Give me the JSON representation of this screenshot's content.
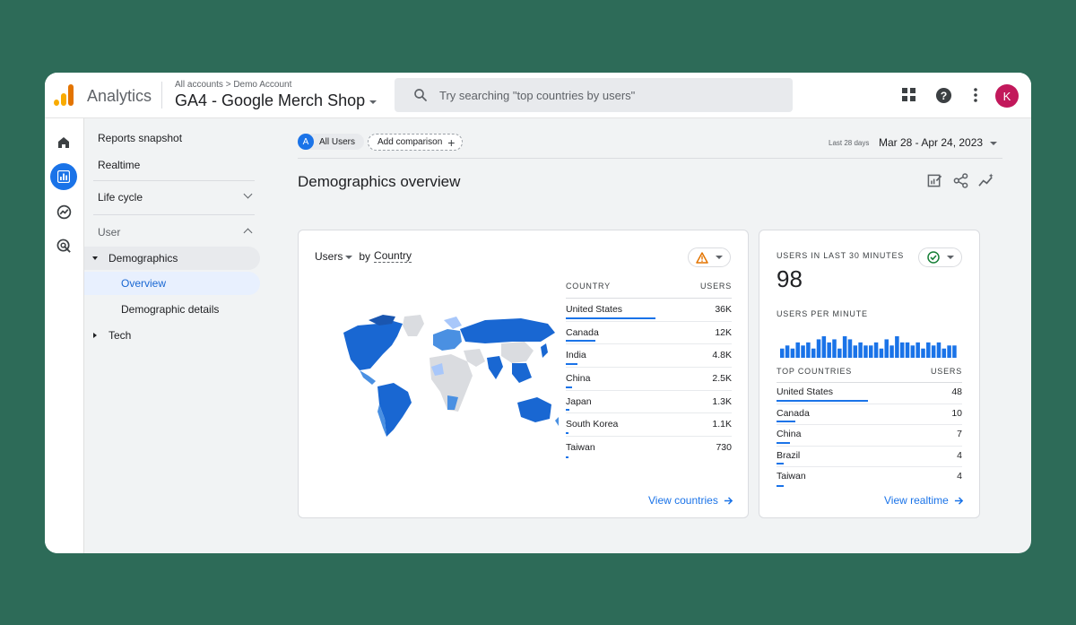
{
  "header": {
    "app_name": "Analytics",
    "breadcrumb": "All accounts > Demo Account",
    "property_name": "GA4 - Google Merch Shop",
    "search_placeholder": "Try searching \"top countries by users\"",
    "avatar_initial": "K"
  },
  "rail": [
    "home-icon",
    "reports-icon",
    "explore-icon",
    "advertising-icon"
  ],
  "nav": {
    "reports_snapshot": "Reports snapshot",
    "realtime": "Realtime",
    "life_cycle": "Life cycle",
    "user": "User",
    "demographics": "Demographics",
    "overview": "Overview",
    "demographic_details": "Demographic details",
    "tech": "Tech"
  },
  "main": {
    "segment_badge": "A",
    "segment_label": "All Users",
    "add_comparison": "Add comparison",
    "date_tag": "Last 28 days",
    "date_range": "Mar 28 - Apr 24, 2023",
    "title": "Demographics overview"
  },
  "country_card": {
    "metric": "Users",
    "by": "by",
    "dimension": "Country",
    "col_country": "COUNTRY",
    "col_users": "USERS",
    "rows": [
      {
        "country": "United States",
        "users": "36K",
        "share": 1.0
      },
      {
        "country": "Canada",
        "users": "12K",
        "share": 0.333
      },
      {
        "country": "India",
        "users": "4.8K",
        "share": 0.133
      },
      {
        "country": "China",
        "users": "2.5K",
        "share": 0.069
      },
      {
        "country": "Japan",
        "users": "1.3K",
        "share": 0.036
      },
      {
        "country": "South Korea",
        "users": "1.1K",
        "share": 0.031
      },
      {
        "country": "Taiwan",
        "users": "730",
        "share": 0.02
      }
    ],
    "link": "View countries"
  },
  "realtime_card": {
    "label_users": "USERS IN LAST 30 MINUTES",
    "users_value": "98",
    "label_per_minute": "USERS PER MINUTE",
    "per_minute": [
      3,
      4,
      3,
      5,
      4,
      5,
      3,
      6,
      7,
      5,
      6,
      3,
      7,
      6,
      4,
      5,
      4,
      4,
      5,
      3,
      6,
      4,
      7,
      5,
      5,
      4,
      5,
      3,
      5,
      4,
      5,
      3,
      4,
      4
    ],
    "col_countries": "TOP COUNTRIES",
    "col_users": "USERS",
    "rows": [
      {
        "country": "United States",
        "users": "48",
        "share": 1.0
      },
      {
        "country": "Canada",
        "users": "10",
        "share": 0.208
      },
      {
        "country": "China",
        "users": "7",
        "share": 0.146
      },
      {
        "country": "Brazil",
        "users": "4",
        "share": 0.083
      },
      {
        "country": "Taiwan",
        "users": "4",
        "share": 0.083
      }
    ],
    "link": "View realtime"
  },
  "colors": {
    "accent": "#1a73e8",
    "map_dark": "#1967d2",
    "map_mid": "#4a90e2",
    "map_light": "#a8c7fa",
    "map_none": "#dadce0",
    "avatar": "#c2185b",
    "background": "#2d6b58"
  }
}
